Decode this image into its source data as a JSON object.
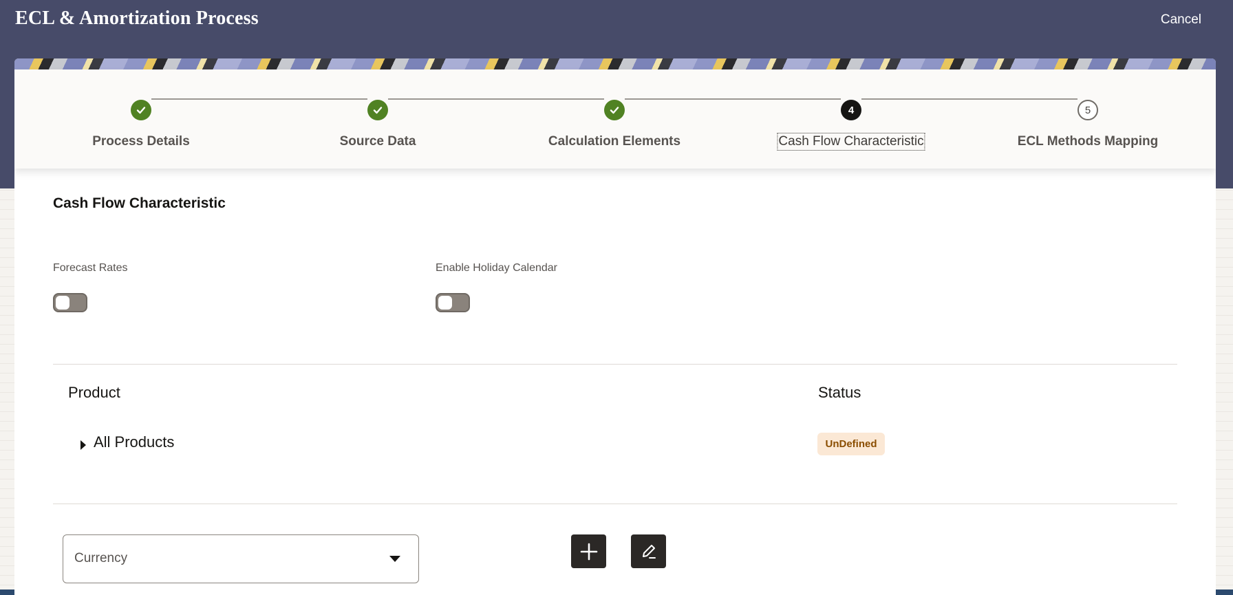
{
  "header": {
    "title": "ECL & Amortization Process",
    "cancel_label": "Cancel"
  },
  "train": {
    "steps": [
      {
        "label": "Process Details",
        "state": "completed",
        "marker": ""
      },
      {
        "label": "Source Data",
        "state": "completed",
        "marker": ""
      },
      {
        "label": "Calculation Elements",
        "state": "completed",
        "marker": ""
      },
      {
        "label": "Cash Flow Characteristic",
        "state": "current",
        "marker": "4"
      },
      {
        "label": "ECL Methods Mapping",
        "state": "future",
        "marker": "5"
      }
    ]
  },
  "section": {
    "title": "Cash Flow Characteristic"
  },
  "toggles": {
    "forecast_rates": {
      "label": "Forecast Rates",
      "on": false
    },
    "holiday_calendar": {
      "label": "Enable Holiday Calendar",
      "on": false
    }
  },
  "table": {
    "headers": {
      "product": "Product",
      "status": "Status"
    },
    "rows": [
      {
        "product": "All Products",
        "status": "UnDefined"
      }
    ]
  },
  "controls": {
    "currency_placeholder": "Currency",
    "add_icon": "plus-icon",
    "edit_icon": "pencil-icon"
  },
  "colors": {
    "header_bg": "#474b69",
    "completed": "#508223",
    "current": "#161513",
    "badge_bg": "#fbe8d5",
    "badge_text": "#8a4d00"
  }
}
